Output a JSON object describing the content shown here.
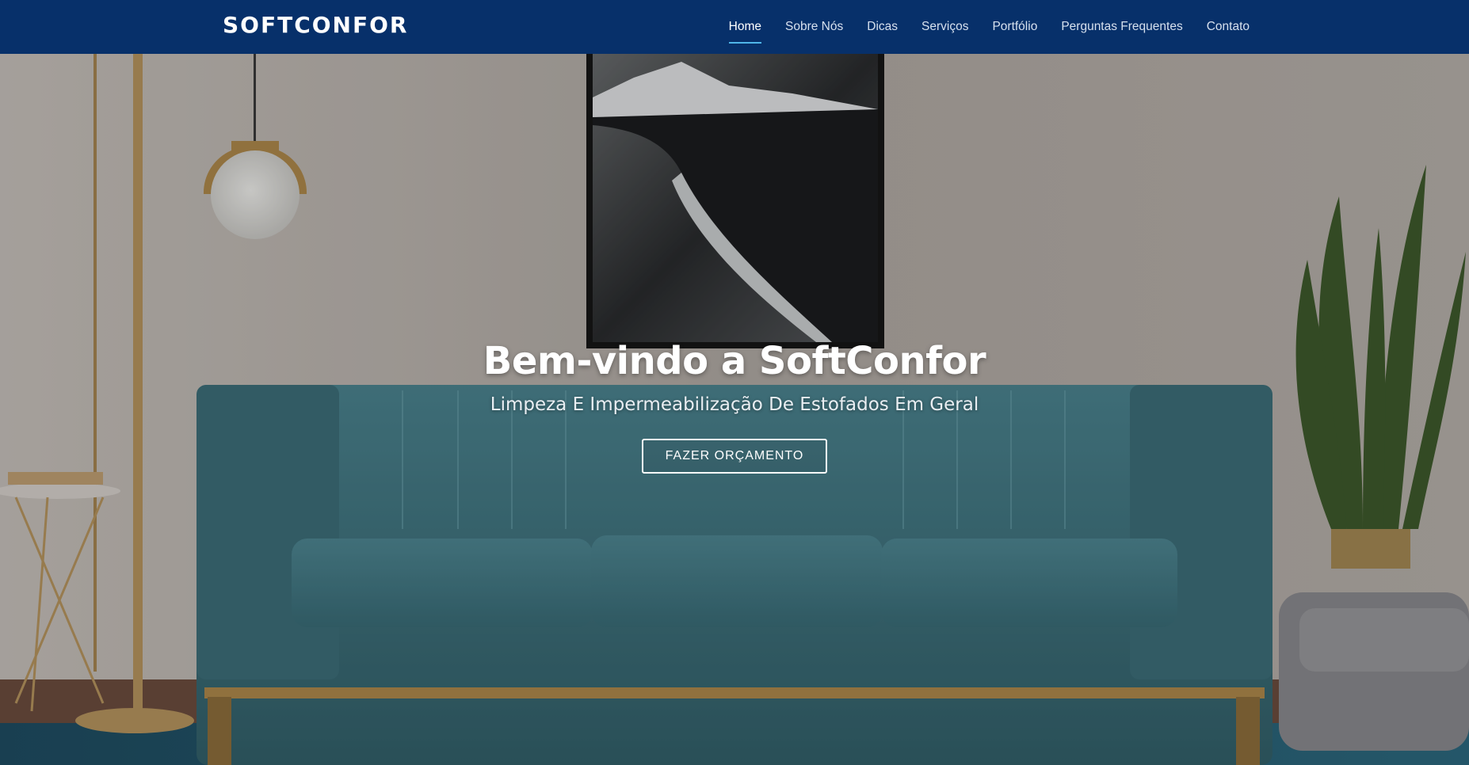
{
  "brand": "SOFTCONFOR",
  "nav": {
    "items": [
      {
        "label": "Home",
        "active": true
      },
      {
        "label": "Sobre Nós"
      },
      {
        "label": "Dicas"
      },
      {
        "label": "Serviços"
      },
      {
        "label": "Portfólio"
      },
      {
        "label": "Perguntas Frequentes"
      },
      {
        "label": "Contato"
      }
    ]
  },
  "hero": {
    "title": "Bem-vindo a SoftConfor",
    "subtitle": "Limpeza E Impermeabilização De Estofados Em Geral",
    "cta_label": "FAZER ORÇAMENTO"
  },
  "colors": {
    "navbar": "#07306a",
    "active_underline": "#4fb6e8",
    "sofa": "#3f6f7a"
  }
}
